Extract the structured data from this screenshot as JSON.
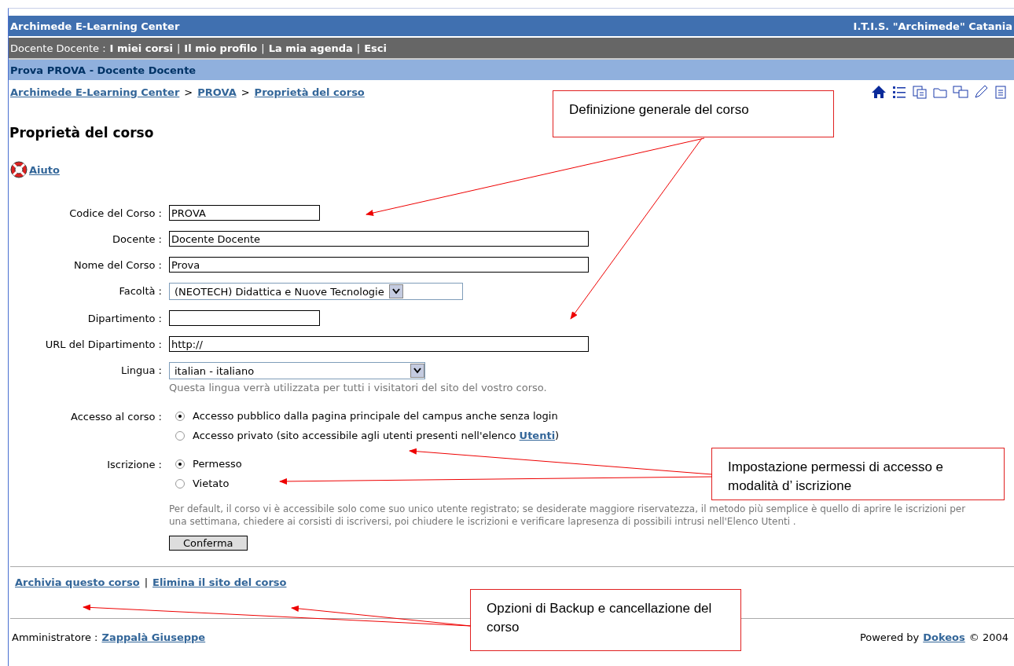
{
  "header": {
    "site": "Archimede E-Learning Center",
    "institution": "I.T.I.S. \"Archimede\" Catania"
  },
  "user_bar": {
    "user": "Docente Docente :",
    "items": [
      {
        "kind": "link",
        "text": "I miei corsi"
      },
      {
        "kind": "separator",
        "text": "|"
      },
      {
        "kind": "link",
        "text": "Il mio profilo"
      },
      {
        "kind": "separator",
        "text": "|"
      },
      {
        "kind": "link",
        "text": "La mia agenda"
      },
      {
        "kind": "separator",
        "text": "|"
      },
      {
        "kind": "link",
        "text": "Esci"
      }
    ]
  },
  "course_bar": {
    "title": "Prova PROVA - Docente Docente"
  },
  "breadcrumb": [
    {
      "kind": "link",
      "text": "Archimede E-Learning Center"
    },
    {
      "kind": "separator",
      "text": ">"
    },
    {
      "kind": "link",
      "text": "PROVA"
    },
    {
      "kind": "separator",
      "text": ">"
    },
    {
      "kind": "link",
      "text": "Proprietà del corso"
    }
  ],
  "page_title": "Proprietà del corso",
  "help_link": "Aiuto",
  "form": {
    "fields": [
      {
        "kind": "short_text",
        "label": "Codice del Corso :",
        "value": "PROVA"
      },
      {
        "kind": "long_text",
        "label": "Docente :",
        "value": "Docente Docente"
      },
      {
        "kind": "long_text",
        "label": "Nome del Corso :",
        "value": "Prova"
      },
      {
        "kind": "select",
        "label": "Facoltà :",
        "value": "(NEOTECH) Didattica e Nuove Tecnologie"
      },
      {
        "kind": "short_text",
        "label": "Dipartimento :"
      },
      {
        "kind": "long_text",
        "label": "URL del Dipartimento :",
        "value": "http://"
      },
      {
        "kind": "wide_select",
        "label": "Lingua :",
        "value": "italian - italiano",
        "hint": "Questa lingua verrà utilizzata per tutti i visitatori del sito del vostro corso."
      }
    ],
    "radio_groups": [
      {
        "label": "Accesso al corso :",
        "options": [
          {
            "text": "Accesso pubblico dalla pagina principale del campus anche senza login",
            "selected": true
          },
          {
            "text": "Accesso privato (sito accessibile agli utenti presenti nell'elenco ",
            "link": "Utenti",
            "after": ")",
            "selected": false
          }
        ]
      },
      {
        "label": "Iscrizione :",
        "options": [
          {
            "text": "Permesso",
            "selected": true
          },
          {
            "text": "Vietato",
            "selected": false
          }
        ]
      }
    ],
    "note": "Per default, il corso vi è accessibile solo come suo unico utente registrato; se desiderate maggiore riservatezza, il metodo più semplice è quello di aprire le iscrizioni per una settimana, chiedere ai corsisti di iscriversi, poi chiudere le iscrizioni e verificare lapresenza di possibili intrusi nell'Elenco Utenti .",
    "submit": "Conferma"
  },
  "course_actions": [
    {
      "kind": "link",
      "text": "Archivia questo corso"
    },
    {
      "kind": "separator",
      "text": "|"
    },
    {
      "kind": "link",
      "text": "Elimina il sito del corso"
    }
  ],
  "footer": {
    "admin_label": "Amministratore :",
    "admin": "Zappalà Giuseppe",
    "powered": "Powered by",
    "powered_link": "Dokeos",
    "copyright": "© 2004"
  },
  "annotations": [
    {
      "text": "Definizione generale del corso"
    },
    {
      "text": "Impostazione permessi di accesso e modalità d’ iscrizione"
    },
    {
      "text": "Opzioni di Backup e cancellazione del corso"
    }
  ]
}
